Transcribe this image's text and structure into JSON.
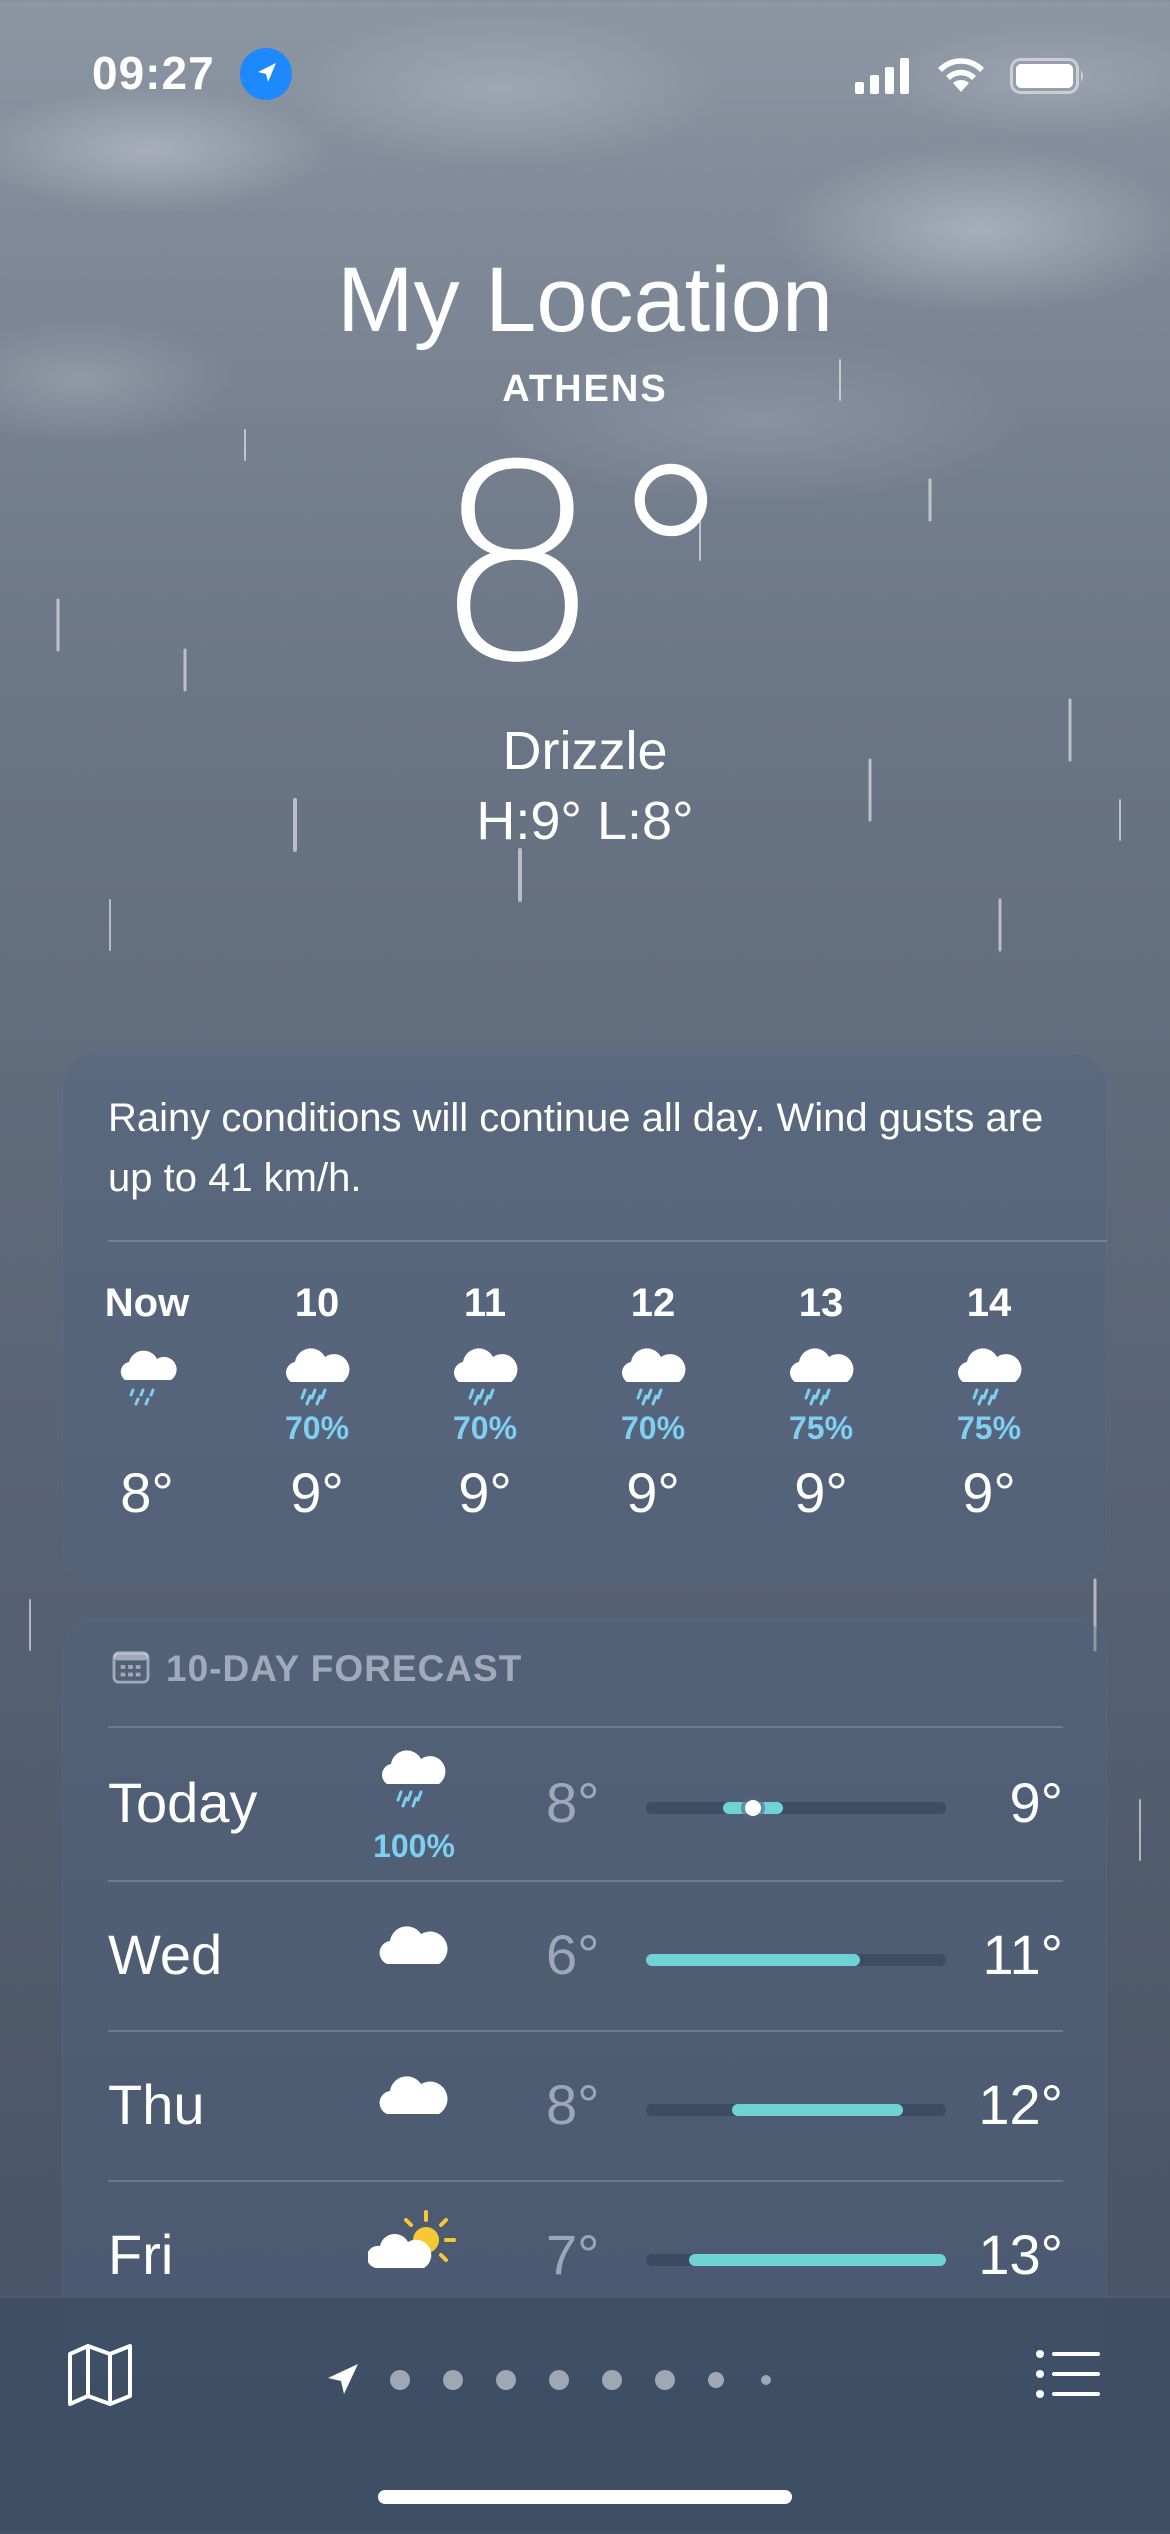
{
  "status_bar": {
    "time": "09:27"
  },
  "header": {
    "title": "My Location",
    "city": "ATHENS",
    "temperature": "8°",
    "condition": "Drizzle",
    "hi_lo": "H:9°  L:8°"
  },
  "hourly": {
    "summary": "Rainy conditions will continue all day. Wind gusts are up to 41 km/h.",
    "items": [
      {
        "label": "Now",
        "icon": "cloud-drizzle-icon",
        "precip": "",
        "temp": "8°"
      },
      {
        "label": "10",
        "icon": "cloud-rain-icon",
        "precip": "70%",
        "temp": "9°"
      },
      {
        "label": "11",
        "icon": "cloud-rain-icon",
        "precip": "70%",
        "temp": "9°"
      },
      {
        "label": "12",
        "icon": "cloud-rain-icon",
        "precip": "70%",
        "temp": "9°"
      },
      {
        "label": "13",
        "icon": "cloud-rain-icon",
        "precip": "75%",
        "temp": "9°"
      },
      {
        "label": "14",
        "icon": "cloud-rain-icon",
        "precip": "75%",
        "temp": "9°"
      }
    ]
  },
  "forecast": {
    "title": "10-DAY FORECAST",
    "range_min": 6,
    "range_max": 13,
    "days": [
      {
        "day": "Today",
        "icon": "cloud-rain-icon",
        "precip": "100%",
        "low": "8°",
        "high": "9°",
        "low_val": 8,
        "high_val": 9,
        "current_val": 8
      },
      {
        "day": "Wed",
        "icon": "cloud-icon",
        "precip": "",
        "low": "6°",
        "high": "11°",
        "low_val": 6,
        "high_val": 11
      },
      {
        "day": "Thu",
        "icon": "cloud-icon",
        "precip": "",
        "low": "8°",
        "high": "12°",
        "low_val": 8,
        "high_val": 12
      },
      {
        "day": "Fri",
        "icon": "partly-sunny-icon",
        "precip": "",
        "low": "7°",
        "high": "13°",
        "low_val": 7,
        "high_val": 13
      }
    ]
  },
  "pager": {
    "pages": 9,
    "current": 0
  },
  "colors": {
    "accent": "#1e88ff",
    "precip": "#7fcff2",
    "temp_bar": "#6fd3d6"
  }
}
